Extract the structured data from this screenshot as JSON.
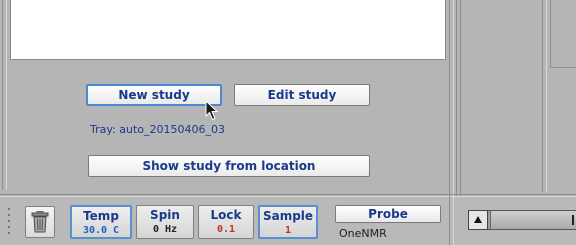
{
  "study_panel": {
    "new_study_label": "New study",
    "edit_study_label": "Edit study",
    "tray_label": "Tray: auto_20150406_03",
    "show_study_label": "Show study from location"
  },
  "status_bar": {
    "temp": {
      "label": "Temp",
      "value": "30.0 C",
      "value_color": "#1a5fc0"
    },
    "spin": {
      "label": "Spin",
      "value": "0 Hz",
      "value_color": "#222222"
    },
    "lock": {
      "label": "Lock",
      "value": "0.1",
      "value_color": "#c0321c"
    },
    "sample": {
      "label": "Sample",
      "value": "1",
      "value_color": "#c0321c"
    },
    "probe": {
      "label": "Probe",
      "value": "OneNMR"
    }
  },
  "icons": [
    "trash-icon",
    "pointer-cursor-icon",
    "scroll-left-arrow-icon"
  ],
  "colors": {
    "accent": "#1a3a8a",
    "panel": "#b5b5b5",
    "focus": "#4a8ad0"
  }
}
